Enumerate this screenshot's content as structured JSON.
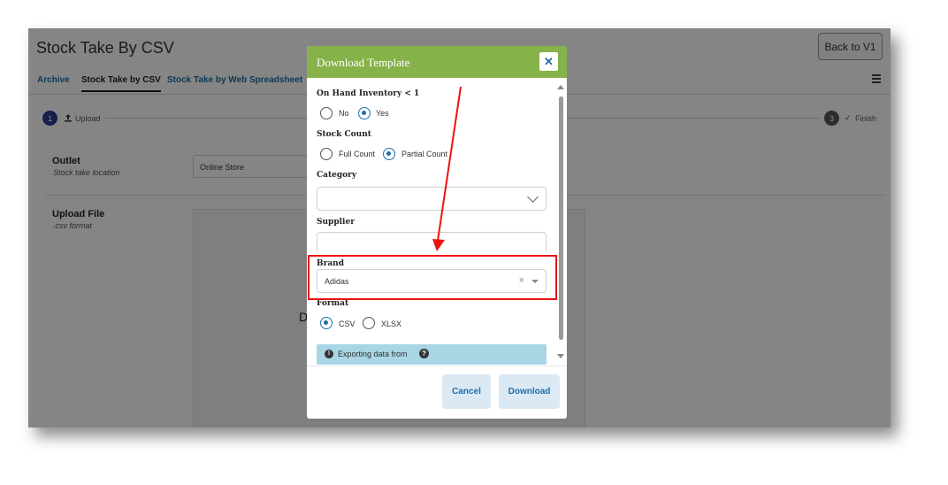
{
  "app": {
    "title": "Stock Take By CSV",
    "back_button": "Back to V1",
    "tabs": [
      {
        "label": "Archive",
        "active": false
      },
      {
        "label": "Stock Take by CSV",
        "active": true
      },
      {
        "label": "Stock Take by Web Spreadsheet",
        "active": false
      }
    ],
    "stepper": {
      "step1_number": "1",
      "step1_label": "Upload",
      "step3_number": "3",
      "step3_label": "Finish"
    },
    "outlet": {
      "label": "Outlet",
      "sub": "Stock take location",
      "value": "Online Store"
    },
    "upload": {
      "label": "Upload File",
      "sub": ".csv format",
      "dropzone_text": "D"
    }
  },
  "modal": {
    "title": "Download Template",
    "close_symbol": "✕",
    "on_hand": {
      "label": "On Hand Inventory < 1",
      "options": [
        "No",
        "Yes"
      ],
      "selected": "Yes"
    },
    "stock_count": {
      "label": "Stock Count",
      "options": [
        "Full Count",
        "Partial Count"
      ],
      "selected": "Partial Count"
    },
    "category": {
      "label": "Category",
      "value": ""
    },
    "supplier": {
      "label": "Supplier",
      "value": ""
    },
    "brand": {
      "label": "Brand",
      "value": "Adidas",
      "clear_symbol": "×"
    },
    "format": {
      "label": "Format",
      "options": [
        "CSV",
        "XLSX"
      ],
      "selected": "CSV"
    },
    "info": {
      "text": "Exporting data from",
      "icon": "!",
      "help": "?"
    },
    "cancel_label": "Cancel",
    "download_label": "Download"
  },
  "colors": {
    "header_green": "#86b24a",
    "link_blue": "#1e6fa8",
    "annotation_red": "#e11"
  }
}
